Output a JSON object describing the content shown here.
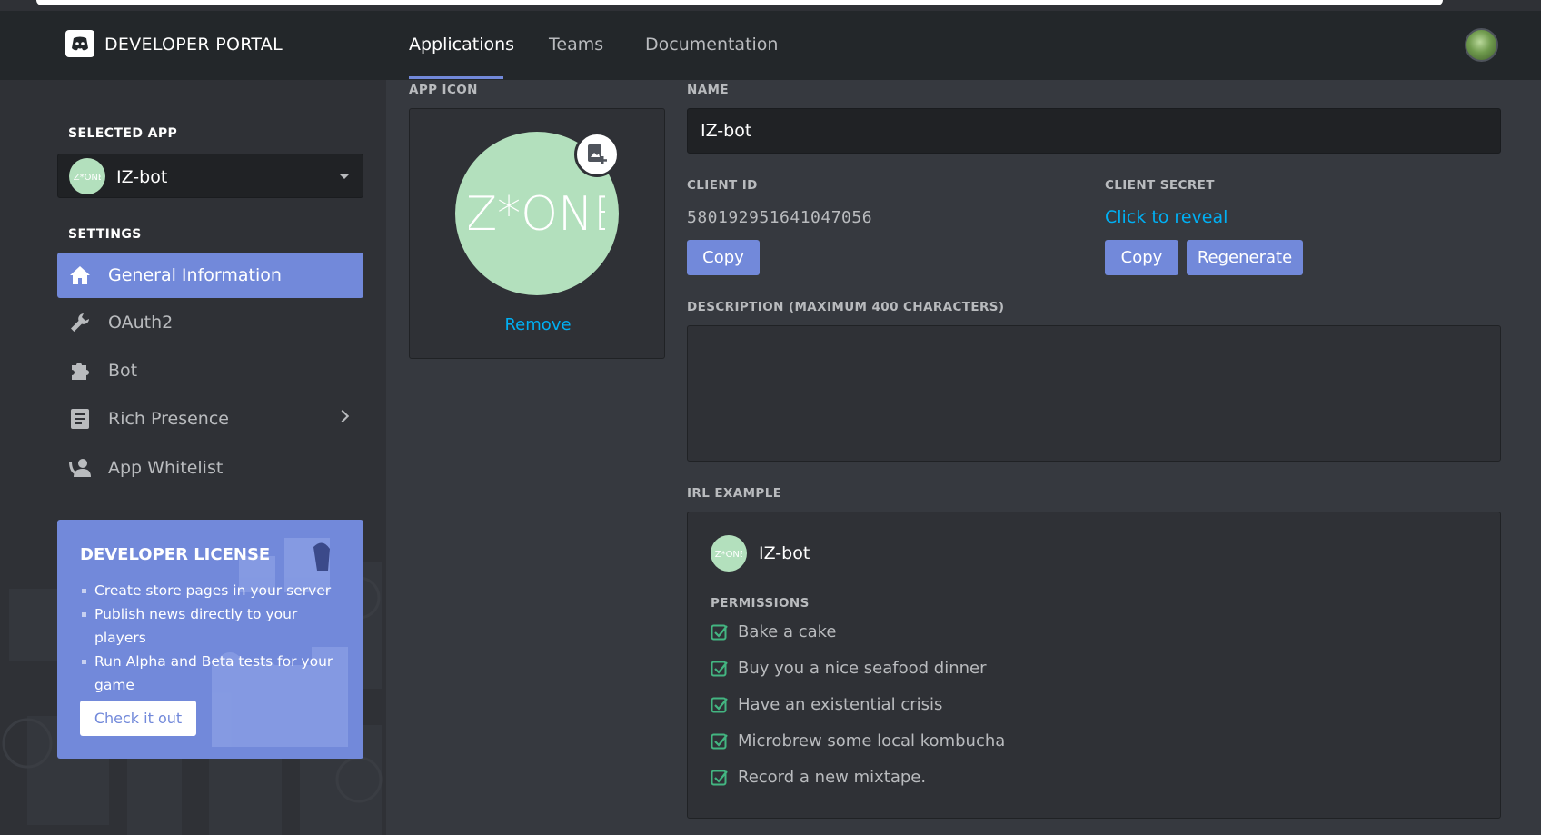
{
  "header": {
    "brand": "DEVELOPER PORTAL",
    "tabs": [
      {
        "label": "Applications",
        "active": true
      },
      {
        "label": "Teams",
        "active": false
      },
      {
        "label": "Documentation",
        "active": false
      }
    ]
  },
  "sidebar": {
    "selected_app_label": "SELECTED APP",
    "selected_app_name": "IZ-bot",
    "settings_label": "SETTINGS",
    "items": [
      {
        "label": "General Information",
        "icon": "home-icon",
        "active": true
      },
      {
        "label": "OAuth2",
        "icon": "wrench-icon",
        "active": false
      },
      {
        "label": "Bot",
        "icon": "puzzle-icon",
        "active": false
      },
      {
        "label": "Rich Presence",
        "icon": "document-icon",
        "active": false
      },
      {
        "label": "App Whitelist",
        "icon": "user-whitelist-icon",
        "active": false
      }
    ],
    "license": {
      "title": "DEVELOPER LICENSE",
      "bullets": [
        "Create store pages in your server",
        "Publish news directly to your players",
        "Run Alpha and Beta tests for your game"
      ],
      "button": "Check it out"
    }
  },
  "main": {
    "app_icon_label": "APP ICON",
    "app_icon_text": "IZ*ONE",
    "remove_label": "Remove",
    "name_label": "NAME",
    "name_value": "IZ-bot",
    "client_id_label": "CLIENT ID",
    "client_id": "580192951641047056",
    "client_secret_label": "CLIENT SECRET",
    "reveal_label": "Click to reveal",
    "copy_label": "Copy",
    "regenerate_label": "Regenerate",
    "description_label": "DESCRIPTION (MAXIMUM 400 CHARACTERS)",
    "description_value": "",
    "irl_label": "IRL EXAMPLE",
    "irl_name": "IZ-bot",
    "permissions_label": "PERMISSIONS",
    "permissions": [
      "Bake a cake",
      "Buy you a nice seafood dinner",
      "Have an existential crisis",
      "Microbrew some local kombucha",
      "Record a new mixtape."
    ]
  },
  "colors": {
    "accent": "#7289da",
    "link": "#00b0f4",
    "check": "#43b581",
    "app_icon_bg": "#b3e0bd"
  }
}
